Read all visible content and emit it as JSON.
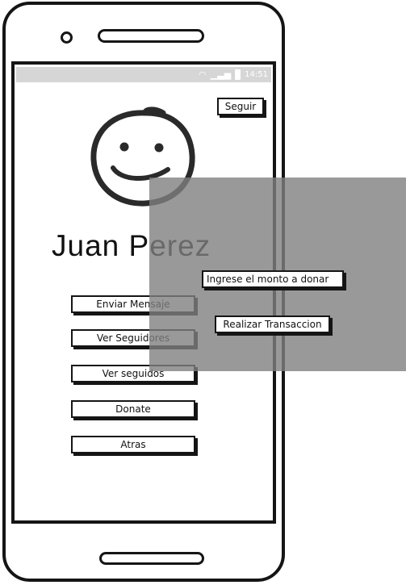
{
  "status_bar": {
    "time": "14:51",
    "wifi_icon": "wifi-icon",
    "signal_icon": "signal-icon",
    "battery_icon": "battery-icon"
  },
  "header": {
    "follow_label": "Seguir"
  },
  "profile": {
    "name": "Juan Perez",
    "avatar_icon": "smiley-face-icon"
  },
  "menu": {
    "items": [
      {
        "label": "Enviar Mensaje"
      },
      {
        "label": "Ver Seguidores"
      },
      {
        "label": "Ver seguidos"
      },
      {
        "label": "Donate"
      },
      {
        "label": "Atras"
      }
    ]
  },
  "donate_dialog": {
    "amount_placeholder": "Ingrese el monto a donar",
    "submit_label": "Realizar Transaccion"
  },
  "colors": {
    "overlay": "#808080",
    "ink": "#151515",
    "status_bar": "#d6d6d6"
  }
}
